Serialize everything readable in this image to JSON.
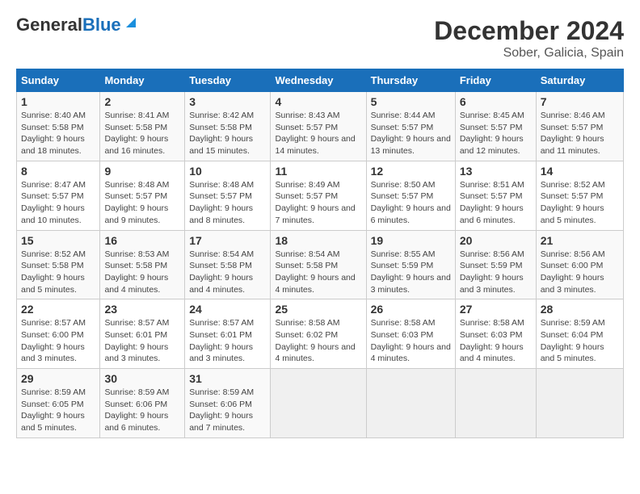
{
  "header": {
    "logo_general": "General",
    "logo_blue": "Blue",
    "title": "December 2024",
    "subtitle": "Sober, Galicia, Spain"
  },
  "calendar": {
    "days_of_week": [
      "Sunday",
      "Monday",
      "Tuesday",
      "Wednesday",
      "Thursday",
      "Friday",
      "Saturday"
    ],
    "weeks": [
      [
        null,
        null,
        null,
        null,
        {
          "day": 1,
          "sunrise": "8:40 AM",
          "sunset": "5:58 PM",
          "daylight_hours": 9,
          "daylight_minutes": 18
        },
        {
          "day": 2,
          "sunrise": "8:41 AM",
          "sunset": "5:58 PM",
          "daylight_hours": 9,
          "daylight_minutes": 16
        },
        {
          "day": 3,
          "sunrise": "8:42 AM",
          "sunset": "5:58 PM",
          "daylight_hours": 9,
          "daylight_minutes": 15
        },
        {
          "day": 4,
          "sunrise": "8:43 AM",
          "sunset": "5:57 PM",
          "daylight_hours": 9,
          "daylight_minutes": 14
        },
        {
          "day": 5,
          "sunrise": "8:44 AM",
          "sunset": "5:57 PM",
          "daylight_hours": 9,
          "daylight_minutes": 13
        },
        {
          "day": 6,
          "sunrise": "8:45 AM",
          "sunset": "5:57 PM",
          "daylight_hours": 9,
          "daylight_minutes": 12
        },
        {
          "day": 7,
          "sunrise": "8:46 AM",
          "sunset": "5:57 PM",
          "daylight_hours": 9,
          "daylight_minutes": 11
        }
      ],
      [
        {
          "day": 8,
          "sunrise": "8:47 AM",
          "sunset": "5:57 PM",
          "daylight_hours": 9,
          "daylight_minutes": 10
        },
        {
          "day": 9,
          "sunrise": "8:48 AM",
          "sunset": "5:57 PM",
          "daylight_hours": 9,
          "daylight_minutes": 9
        },
        {
          "day": 10,
          "sunrise": "8:48 AM",
          "sunset": "5:57 PM",
          "daylight_hours": 9,
          "daylight_minutes": 8
        },
        {
          "day": 11,
          "sunrise": "8:49 AM",
          "sunset": "5:57 PM",
          "daylight_hours": 9,
          "daylight_minutes": 7
        },
        {
          "day": 12,
          "sunrise": "8:50 AM",
          "sunset": "5:57 PM",
          "daylight_hours": 9,
          "daylight_minutes": 6
        },
        {
          "day": 13,
          "sunrise": "8:51 AM",
          "sunset": "5:57 PM",
          "daylight_hours": 9,
          "daylight_minutes": 6
        },
        {
          "day": 14,
          "sunrise": "8:52 AM",
          "sunset": "5:57 PM",
          "daylight_hours": 9,
          "daylight_minutes": 5
        }
      ],
      [
        {
          "day": 15,
          "sunrise": "8:52 AM",
          "sunset": "5:58 PM",
          "daylight_hours": 9,
          "daylight_minutes": 5
        },
        {
          "day": 16,
          "sunrise": "8:53 AM",
          "sunset": "5:58 PM",
          "daylight_hours": 9,
          "daylight_minutes": 4
        },
        {
          "day": 17,
          "sunrise": "8:54 AM",
          "sunset": "5:58 PM",
          "daylight_hours": 9,
          "daylight_minutes": 4
        },
        {
          "day": 18,
          "sunrise": "8:54 AM",
          "sunset": "5:58 PM",
          "daylight_hours": 9,
          "daylight_minutes": 4
        },
        {
          "day": 19,
          "sunrise": "8:55 AM",
          "sunset": "5:59 PM",
          "daylight_hours": 9,
          "daylight_minutes": 3
        },
        {
          "day": 20,
          "sunrise": "8:56 AM",
          "sunset": "5:59 PM",
          "daylight_hours": 9,
          "daylight_minutes": 3
        },
        {
          "day": 21,
          "sunrise": "8:56 AM",
          "sunset": "6:00 PM",
          "daylight_hours": 9,
          "daylight_minutes": 3
        }
      ],
      [
        {
          "day": 22,
          "sunrise": "8:57 AM",
          "sunset": "6:00 PM",
          "daylight_hours": 9,
          "daylight_minutes": 3
        },
        {
          "day": 23,
          "sunrise": "8:57 AM",
          "sunset": "6:01 PM",
          "daylight_hours": 9,
          "daylight_minutes": 3
        },
        {
          "day": 24,
          "sunrise": "8:57 AM",
          "sunset": "6:01 PM",
          "daylight_hours": 9,
          "daylight_minutes": 3
        },
        {
          "day": 25,
          "sunrise": "8:58 AM",
          "sunset": "6:02 PM",
          "daylight_hours": 9,
          "daylight_minutes": 4
        },
        {
          "day": 26,
          "sunrise": "8:58 AM",
          "sunset": "6:03 PM",
          "daylight_hours": 9,
          "daylight_minutes": 4
        },
        {
          "day": 27,
          "sunrise": "8:58 AM",
          "sunset": "6:03 PM",
          "daylight_hours": 9,
          "daylight_minutes": 4
        },
        {
          "day": 28,
          "sunrise": "8:59 AM",
          "sunset": "6:04 PM",
          "daylight_hours": 9,
          "daylight_minutes": 5
        }
      ],
      [
        {
          "day": 29,
          "sunrise": "8:59 AM",
          "sunset": "6:05 PM",
          "daylight_hours": 9,
          "daylight_minutes": 5
        },
        {
          "day": 30,
          "sunrise": "8:59 AM",
          "sunset": "6:06 PM",
          "daylight_hours": 9,
          "daylight_minutes": 6
        },
        {
          "day": 31,
          "sunrise": "8:59 AM",
          "sunset": "6:06 PM",
          "daylight_hours": 9,
          "daylight_minutes": 7
        },
        null,
        null,
        null,
        null
      ]
    ]
  }
}
